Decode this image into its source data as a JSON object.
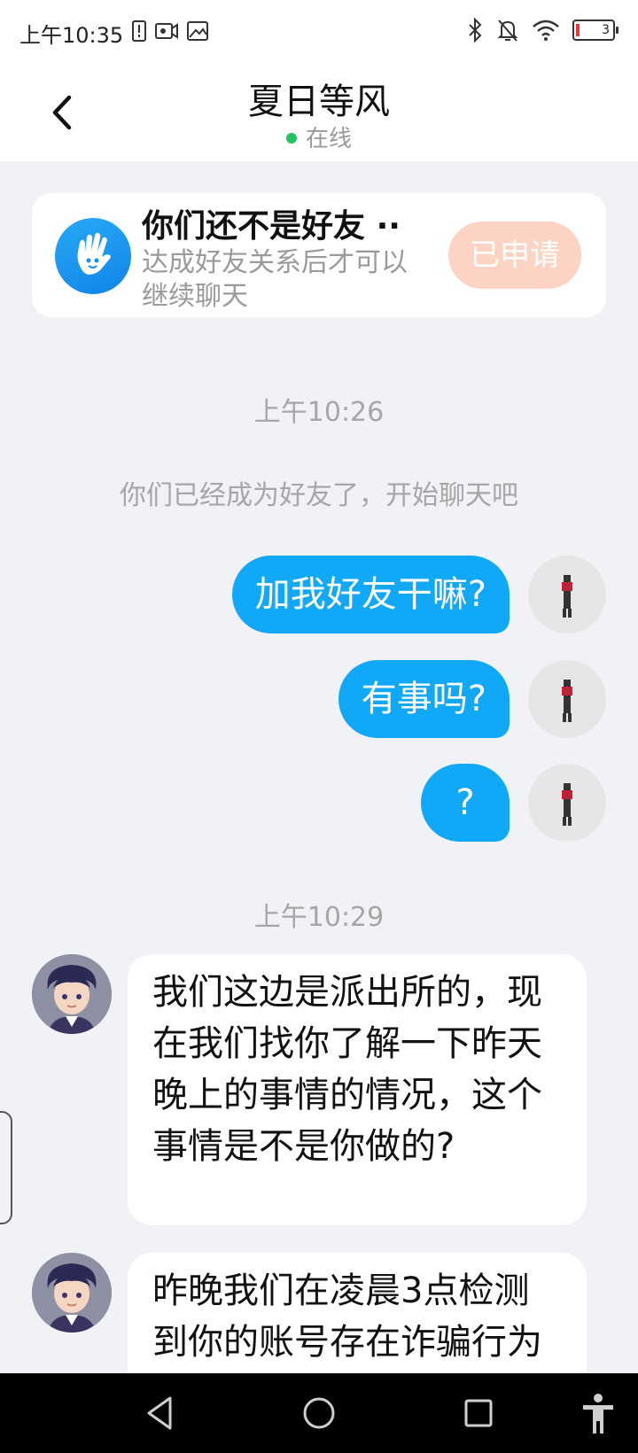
{
  "status_bar": {
    "time": "上午10:35",
    "battery_level": "3"
  },
  "header": {
    "title": "夏日等风",
    "presence": "在线"
  },
  "friend_card": {
    "title": "你们还不是好友",
    "ellipsis": "··",
    "description": "达成好友关系后才可以继续聊天",
    "button_label": "已申请"
  },
  "chat": {
    "timestamp_1": "上午10:26",
    "system_notice": "你们已经成为好友了，开始聊天吧",
    "sent_messages": [
      "加我好友干嘛?",
      "有事吗?",
      "?"
    ],
    "timestamp_2": "上午10:29",
    "received_messages": [
      "我们这边是派出所的，现在我们找你了解一下昨天晚上的事情的情况，这个事情是不是你做的?",
      "昨晚我们在凌晨3点检测到你的账号存在诈骗行为"
    ]
  },
  "colors": {
    "accent_blue": "#12a8f8",
    "online_green": "#22c55e",
    "applied_button": "#fdd4c3"
  },
  "icons": [
    "back-arrow-icon",
    "bluetooth-icon",
    "mute-bell-icon",
    "wifi-icon",
    "battery-icon",
    "hand-wave-icon",
    "nav-back-icon",
    "nav-home-icon",
    "nav-recents-icon",
    "accessibility-icon"
  ]
}
